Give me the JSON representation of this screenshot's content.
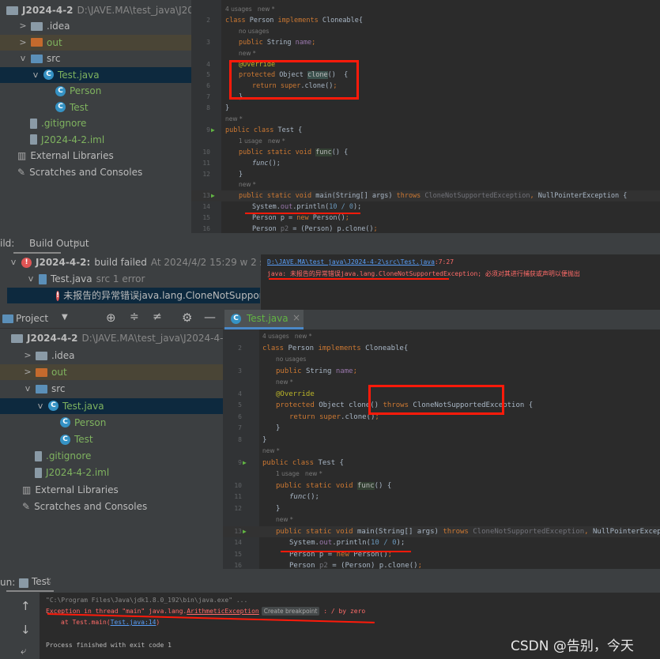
{
  "top": {
    "project_name": "J2024-4-2",
    "project_path": "D:\\JAVE.MA\\test_java\\J2024-4-2",
    "tree": [
      {
        "label": ".idea",
        "kind": "folder",
        "chev": ">"
      },
      {
        "label": "out",
        "kind": "folder-orange",
        "chev": ">"
      },
      {
        "label": "src",
        "kind": "folder-blue",
        "chev": "v"
      },
      {
        "label": "Test.java",
        "kind": "java",
        "chev": "v"
      },
      {
        "label": "Person",
        "kind": "class"
      },
      {
        "label": "Test",
        "kind": "class"
      },
      {
        "label": ".gitignore",
        "kind": "file"
      },
      {
        "label": "J2024-4-2.iml",
        "kind": "file"
      },
      {
        "label": "External Libraries",
        "kind": "lib"
      },
      {
        "label": "Scratches and Consoles",
        "kind": "scratch"
      }
    ],
    "code": [
      {
        "n": "",
        "t": [
          [
            "4 usages   new *",
            "hint"
          ]
        ],
        "i": 0
      },
      {
        "n": "2",
        "t": [
          [
            "class ",
            "kw"
          ],
          [
            "Person ",
            "cl"
          ],
          [
            "implements ",
            "kw"
          ],
          [
            "Cloneable{",
            "cl"
          ]
        ],
        "i": 0
      },
      {
        "n": "",
        "t": [
          [
            "no usages",
            "hint"
          ]
        ],
        "i": 1
      },
      {
        "n": "3",
        "t": [
          [
            "public ",
            "kw"
          ],
          [
            "String ",
            "cl"
          ],
          [
            "name",
            "fld"
          ],
          [
            ";",
            "kw"
          ]
        ],
        "i": 1
      },
      {
        "n": "",
        "t": [
          [
            "new *",
            "hint"
          ]
        ],
        "i": 1
      },
      {
        "n": "4",
        "t": [
          [
            "@Override",
            "ann"
          ]
        ],
        "i": 1
      },
      {
        "n": "5",
        "t": [
          [
            "protected ",
            "kw"
          ],
          [
            "Object ",
            "cl"
          ],
          [
            "clone",
            "hl"
          ],
          [
            "()  {",
            "cl"
          ]
        ],
        "i": 1
      },
      {
        "n": "6",
        "t": [
          [
            "return ",
            "kw"
          ],
          [
            "super",
            "kw"
          ],
          [
            ".clone()",
            "cl"
          ],
          [
            ";",
            "kw"
          ]
        ],
        "i": 2
      },
      {
        "n": "7",
        "t": [
          [
            "}",
            "cl"
          ]
        ],
        "i": 1
      },
      {
        "n": "8",
        "t": [
          [
            "}",
            "cl"
          ]
        ],
        "i": 0
      },
      {
        "n": "",
        "t": [
          [
            "new *",
            "hint"
          ]
        ],
        "i": 0
      },
      {
        "n": "9",
        "t": [
          [
            "public class ",
            "kw"
          ],
          [
            "Test {",
            "cl"
          ]
        ],
        "i": 0
      },
      {
        "n": "",
        "t": [
          [
            "1 usage   new *",
            "hint"
          ]
        ],
        "i": 1
      },
      {
        "n": "10",
        "t": [
          [
            "public static void ",
            "kw"
          ],
          [
            "func",
            "hl2"
          ],
          [
            "() {",
            "cl"
          ]
        ],
        "i": 1
      },
      {
        "n": "11",
        "t": [
          [
            "func",
            "fn"
          ],
          [
            "();",
            "cl"
          ]
        ],
        "i": 2
      },
      {
        "n": "12",
        "t": [
          [
            "}",
            "cl"
          ]
        ],
        "i": 1
      },
      {
        "n": "",
        "t": [
          [
            "new *",
            "hint"
          ]
        ],
        "i": 1
      },
      {
        "n": "13",
        "t": [
          [
            "public static void ",
            "kw"
          ],
          [
            "main(String[] args) ",
            "cl"
          ],
          [
            "throws ",
            "kw"
          ],
          [
            "CloneNotSupportedException",
            "gray"
          ],
          [
            ", ",
            "kw"
          ],
          [
            "NullPointerException {",
            "cl"
          ]
        ],
        "i": 1,
        "cur": true
      },
      {
        "n": "14",
        "t": [
          [
            "System.",
            "cl"
          ],
          [
            "out",
            "fld"
          ],
          [
            ".println(",
            "cl"
          ],
          [
            "10 / 0",
            "num"
          ],
          [
            ");",
            "cl"
          ]
        ],
        "i": 2
      },
      {
        "n": "15",
        "t": [
          [
            "Person p = ",
            "cl"
          ],
          [
            "new ",
            "kw"
          ],
          [
            "Person()",
            "cl"
          ],
          [
            ";",
            "kw"
          ]
        ],
        "i": 2
      },
      {
        "n": "16",
        "t": [
          [
            "Person ",
            "cl"
          ],
          [
            "p2",
            "gray"
          ],
          [
            " = (Person) p.clone()",
            "cl"
          ],
          [
            ";",
            "kw"
          ]
        ],
        "i": 2
      }
    ]
  },
  "build": {
    "label": "ild:",
    "tab": "Build Output",
    "project": "J2024-4-2:",
    "status": "build failed",
    "time": "At 2024/4/2 15:29 w 2 sec, 405 ms",
    "file": "Test.java",
    "file_meta": "src 1 error",
    "error": "未报告的异常错误java.lang.CloneNotSupportedExce",
    "detail_link": "D:\\JAVE.MA\\test_java\\J2024-4-2\\src\\Test.java",
    "detail_pos": ":7:27",
    "detail_msg": "java: 未报告的异常错误java.lang.CloneNotSupportedException; 必须对其进行捕获或声明以便抛出"
  },
  "bottom": {
    "project_tab": "Project",
    "editor_tab": "Test.java",
    "project_name": "J2024-4-2",
    "project_path": "D:\\JAVE.MA\\test_java\\J2024-4-2",
    "code5": [
      [
        "protected ",
        "kw"
      ],
      [
        "Object ",
        "cl"
      ],
      [
        "clone() ",
        "cl"
      ],
      [
        "throws ",
        "kw"
      ],
      [
        "CloneNotSupportedException ",
        "cl"
      ],
      [
        "{",
        "cl"
      ]
    ]
  },
  "run": {
    "label": "un:",
    "tab": "Test",
    "cmd": "\"C:\\Program Files\\Java\\jdk1.8.0_192\\bin\\java.exe\" ...",
    "exc_prefix": "Exception in thread \"main\" java.lang.",
    "exc_class": "ArithmeticException",
    "breakpoint": "Create breakpoint",
    "exc_suffix": " : / by zero",
    "at": "at Test.main(",
    "at_link": "Test.java:14",
    "at_end": ")",
    "finished": "Process finished with exit code 1"
  },
  "watermark": "CSDN @告别，今天"
}
